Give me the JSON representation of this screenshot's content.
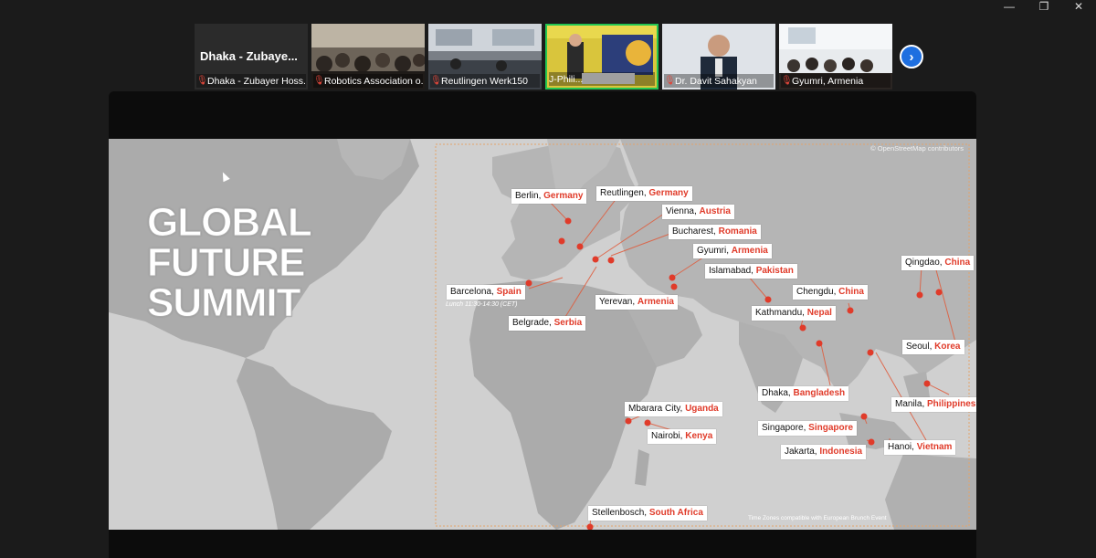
{
  "window_controls": {
    "minimize": "—",
    "restore": "❐",
    "close": "✕"
  },
  "participants": [
    {
      "big_name": "Dhaka - Zubaye...",
      "label": "Dhaka - Zubayer Hoss...",
      "muted": true,
      "active": false
    },
    {
      "label": "Robotics Association o...",
      "muted": true,
      "active": false
    },
    {
      "label": "Reutlingen Werk150",
      "muted": true,
      "active": false
    },
    {
      "label": "J-Phili...",
      "muted": false,
      "active": true
    },
    {
      "label": "Dr. Davit Sahakyan",
      "muted": true,
      "active": false
    },
    {
      "label": "Gyumri, Armenia",
      "muted": true,
      "active": false
    }
  ],
  "next_button": "›",
  "slide": {
    "title_lines": [
      "GLOBAL",
      "FUTURE",
      "SUMMIT"
    ],
    "osm_credit": "© OpenStreetMap contributors",
    "time_zone_note": "Time Zones compatible with European Brunch Event",
    "lunch_note": "Lunch 11:30-14:30 (CET)",
    "accent_color": "#e03b2a",
    "cities": [
      {
        "city": "Berlin, ",
        "country": "Germany"
      },
      {
        "city": "Reutlingen, ",
        "country": "Germany"
      },
      {
        "city": "Vienna, ",
        "country": "Austria"
      },
      {
        "city": "Bucharest, ",
        "country": "Romania"
      },
      {
        "city": "Gyumri, ",
        "country": "Armenia"
      },
      {
        "city": "Islamabad, ",
        "country": "Pakistan"
      },
      {
        "city": "Barcelona, ",
        "country": "Spain"
      },
      {
        "city": "Yerevan, ",
        "country": "Armenia"
      },
      {
        "city": "Belgrade, ",
        "country": "Serbia"
      },
      {
        "city": "Chengdu, ",
        "country": "China"
      },
      {
        "city": "Kathmandu, ",
        "country": "Nepal"
      },
      {
        "city": "Qingdao, ",
        "country": "China"
      },
      {
        "city": "Seoul, ",
        "country": "Korea"
      },
      {
        "city": "Dhaka, ",
        "country": "Bangladesh"
      },
      {
        "city": "Manila, ",
        "country": "Philippines"
      },
      {
        "city": "Mbarara City, ",
        "country": "Uganda"
      },
      {
        "city": "Singapore, ",
        "country": "Singapore"
      },
      {
        "city": "Nairobi, ",
        "country": "Kenya"
      },
      {
        "city": "Hanoi, ",
        "country": "Vietnam"
      },
      {
        "city": "Jakarta, ",
        "country": "Indonesia"
      },
      {
        "city": "Stellenbosch, ",
        "country": "South Africa"
      }
    ]
  }
}
